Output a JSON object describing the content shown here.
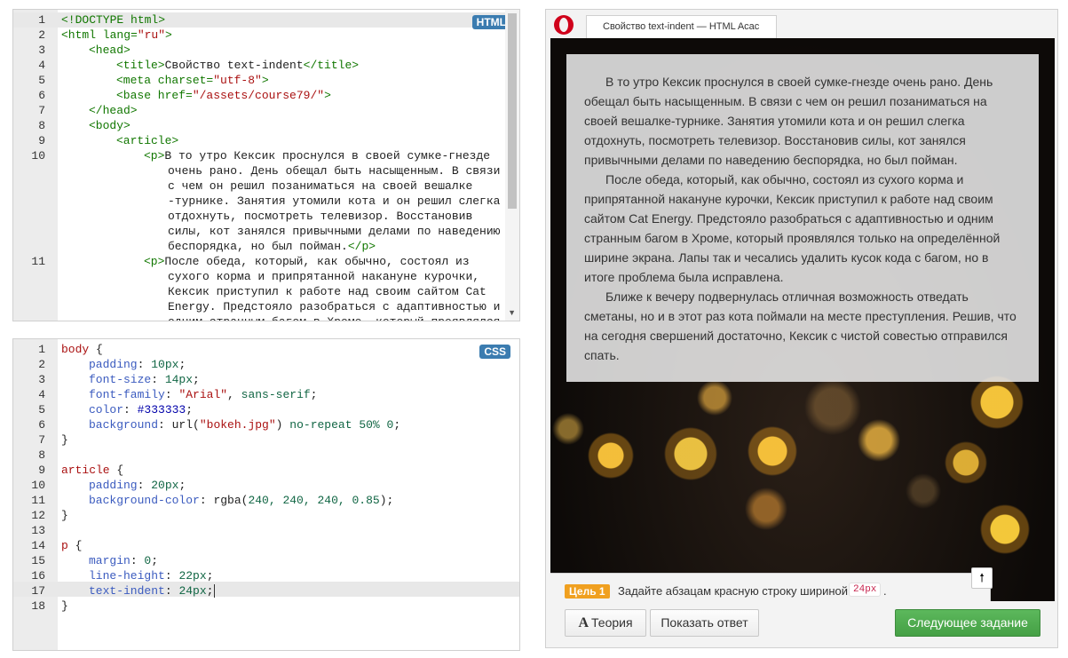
{
  "html_editor": {
    "badge": "HTML",
    "line_numbers": [
      "1",
      "2",
      "3",
      "4",
      "5",
      "6",
      "7",
      "8",
      "9",
      "10",
      "11"
    ],
    "lines": {
      "l1": "<!DOCTYPE html>",
      "l2_tag": "<html lang=",
      "l2_val": "\"ru\"",
      "l2_end": ">",
      "l3": "<head>",
      "l4_open": "<title>",
      "l4_text": "Свойство text-indent",
      "l4_close": "</title>",
      "l5_tag": "<meta charset=",
      "l5_val": "\"utf-8\"",
      "l5_end": ">",
      "l6_tag": "<base href=",
      "l6_val": "\"/assets/course79/\"",
      "l6_end": ">",
      "l7": "</head>",
      "l8": "<body>",
      "l9": "<article>",
      "l10_open": "<p>",
      "l10_text_1": "В то утро Кексик проснулся в своей сумке-гнезде",
      "l10_text_2": "очень рано. День обещал быть насыщенным. В связи",
      "l10_text_3": "с чем он решил позаниматься на своей вешалке",
      "l10_text_4": "-турнике. Занятия утомили кота и он решил слегка",
      "l10_text_5": "отдохнуть, посмотреть телевизор. Восстановив",
      "l10_text_6": "силы, кот занялся привычными делами по наведению",
      "l10_text_7": "беспорядка, но был пойман.",
      "l10_close": "</p>",
      "l11_open": "<p>",
      "l11_text_1": "После обеда, который, как обычно, состоял из",
      "l11_text_2": "сухого корма и припрятанной накануне курочки,",
      "l11_text_3": "Кексик приступил к работе над своим сайтом Cat",
      "l11_text_4": "Energy. Предстояло разобраться с адаптивностью и",
      "l11_text_5": "одним странным багом в Хроме, который проявлялся"
    }
  },
  "css_editor": {
    "badge": "CSS",
    "line_numbers": [
      "1",
      "2",
      "3",
      "4",
      "5",
      "6",
      "7",
      "8",
      "9",
      "10",
      "11",
      "12",
      "13",
      "14",
      "15",
      "16",
      "17",
      "18"
    ],
    "lines": {
      "l1_sel": "body",
      "l1_brace": " {",
      "l2_prop": "padding",
      "l2_val": "10px",
      "l3_prop": "font-size",
      "l3_val": "14px",
      "l4_prop": "font-family",
      "l4_val1": "\"Arial\"",
      "l4_val2": "sans-serif",
      "l5_prop": "color",
      "l5_val": "#333333",
      "l6_prop": "background",
      "l6_fn": "url(",
      "l6_str": "\"bokeh.jpg\"",
      "l6_fn_close": ")",
      "l6_kw": "no-repeat",
      "l6_n1": "50%",
      "l6_n2": "0",
      "l7": "}",
      "l9_sel": "article",
      "l9_brace": " {",
      "l10_prop": "padding",
      "l10_val": "20px",
      "l11_prop": "background-color",
      "l11_fn": "rgba(",
      "l11_n": "240, 240, 240, 0.85",
      "l11_close": ");",
      "l12": "}",
      "l14_sel": "p",
      "l14_brace": " {",
      "l15_prop": "margin",
      "l15_val": "0",
      "l16_prop": "line-height",
      "l16_val": "22px",
      "l17_prop": "text-indent",
      "l17_val": "24px",
      "l18": "}"
    }
  },
  "preview": {
    "tab_title": "Свойство text-indent — HTML Acac",
    "paragraphs": [
      "В то утро Кексик проснулся в своей сумке-гнезде очень рано. День обещал быть насыщенным. В связи с чем он решил позаниматься на своей вешалке-турнике. Занятия утомили кота и он решил слегка отдохнуть, посмотреть телевизор. Восстановив силы, кот занялся привычными делами по наведению беспорядка, но был пойман.",
      "После обеда, который, как обычно, состоял из сухого корма и припрятанной накануне курочки, Кексик приступил к работе над своим сайтом Cat Energy. Предстояло разобраться с адаптивностью и одним странным багом в Хроме, который проявлялся только на определённой ширине экрана. Лапы так и чесались удалить кусок кода с багом, но в итоге проблема была исправлена.",
      "Ближе к вечеру подвернулась отличная возможность отведать сметаны, но и в этот раз кота поймали на месте преступления. Решив, что на сегодня свершений достаточно, Кексик с чистой совестью отправился спать."
    ]
  },
  "task": {
    "goal_label": "Цель 1",
    "goal_text": "Задайте абзацам красную строку шириной",
    "goal_code": "24px",
    "goal_end": "."
  },
  "buttons": {
    "theory_icon": "A",
    "theory": "Теория",
    "show_answer": "Показать ответ",
    "next_task": "Следующее задание",
    "scroll_up": "🠕"
  },
  "colors": {
    "accent_blue": "#3b7cb0",
    "goal_orange": "#f0a020",
    "next_green": "#4cae4c"
  }
}
